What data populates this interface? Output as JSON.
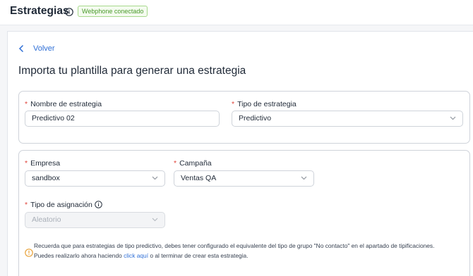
{
  "header": {
    "title": "Estrategias",
    "icon": "info-circle-icon",
    "status_badge": "Webphone conectado",
    "badge_color": "#4a9a2a"
  },
  "nav": {
    "back_label": "Volver",
    "back_icon": "chevron-left-icon"
  },
  "page": {
    "heading": "Importa tu plantilla para generar una estrategia"
  },
  "form": {
    "required_marker": "*",
    "strategy_name": {
      "label": "Nombre de estrategia",
      "value": "Predictivo 02"
    },
    "strategy_type": {
      "label": "Tipo de estrategia",
      "value": "Predictivo"
    },
    "company": {
      "label": "Empresa",
      "value": "sandbox"
    },
    "campaign": {
      "label": "Campaña",
      "value": "Ventas QA"
    },
    "assignment_type": {
      "label": "Tipo de asignación",
      "value": "Aleatorio",
      "disabled": true
    }
  },
  "notice": {
    "icon": "warning-circle-icon",
    "line1": "Recuerda que para estrategias de tipo predictivo, debes tener configurado el equivalente del tipo de grupo \"No contacto\" en el apartado de tipificaciones.",
    "line2_before": "Puedes realizarlo ahora haciendo ",
    "link": "click aquí",
    "line2_after": " o al terminar de crear esta estrategia.",
    "icon_color": "#e8a23a"
  },
  "colors": {
    "accent": "#2f6fd6",
    "required": "#e0453c"
  }
}
